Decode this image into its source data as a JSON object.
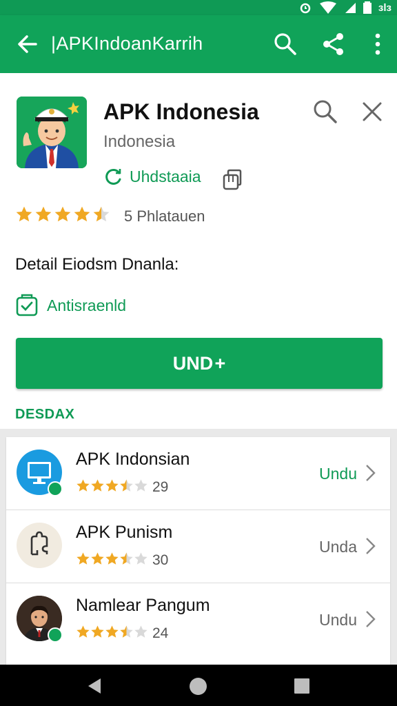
{
  "colors": {
    "primary": "#10a359",
    "primary_dark": "#0f9a55",
    "star": "#f0a823",
    "star_empty": "#d9d9d9",
    "background": "#e9e9e9",
    "nav": "#000000"
  },
  "status_bar": {
    "text": "ɜlɜ",
    "icons": [
      "alarm-icon",
      "wifi-icon",
      "signal-icon",
      "battery-icon"
    ]
  },
  "app_bar": {
    "title": "|APKIndoanKarrih",
    "icons": [
      "back-arrow-icon",
      "search-icon",
      "share-icon",
      "more-vert-icon"
    ]
  },
  "app": {
    "name": "APK Indonesia",
    "developer": "Indonesia",
    "status_label": "Uhdstaaia",
    "rating": 4.5,
    "rating_text": "5 Phlatauen",
    "detail_label": "Detail Eiodsm Dnanla:",
    "antivirus_label": "Antisraenld",
    "download_label": "UND +",
    "section_label": "DESDAX"
  },
  "related": [
    {
      "title": "APK Indonsian",
      "rating": 3.5,
      "rating_count": "29",
      "action": "Undu",
      "action_color": "#0f9a55",
      "icon": "monitor-icon"
    },
    {
      "title": "APK Punism",
      "rating": 3.5,
      "rating_count": "30",
      "action": "Unda",
      "action_color": "#666666",
      "icon": "puzzle-icon"
    },
    {
      "title": "Namlear Pangum",
      "rating": 3.5,
      "rating_count": "24",
      "action": "Undu",
      "action_color": "#666666",
      "icon": "avatar-icon"
    }
  ],
  "nav": {
    "icons": [
      "nav-back-icon",
      "nav-home-icon",
      "nav-recent-icon"
    ]
  }
}
